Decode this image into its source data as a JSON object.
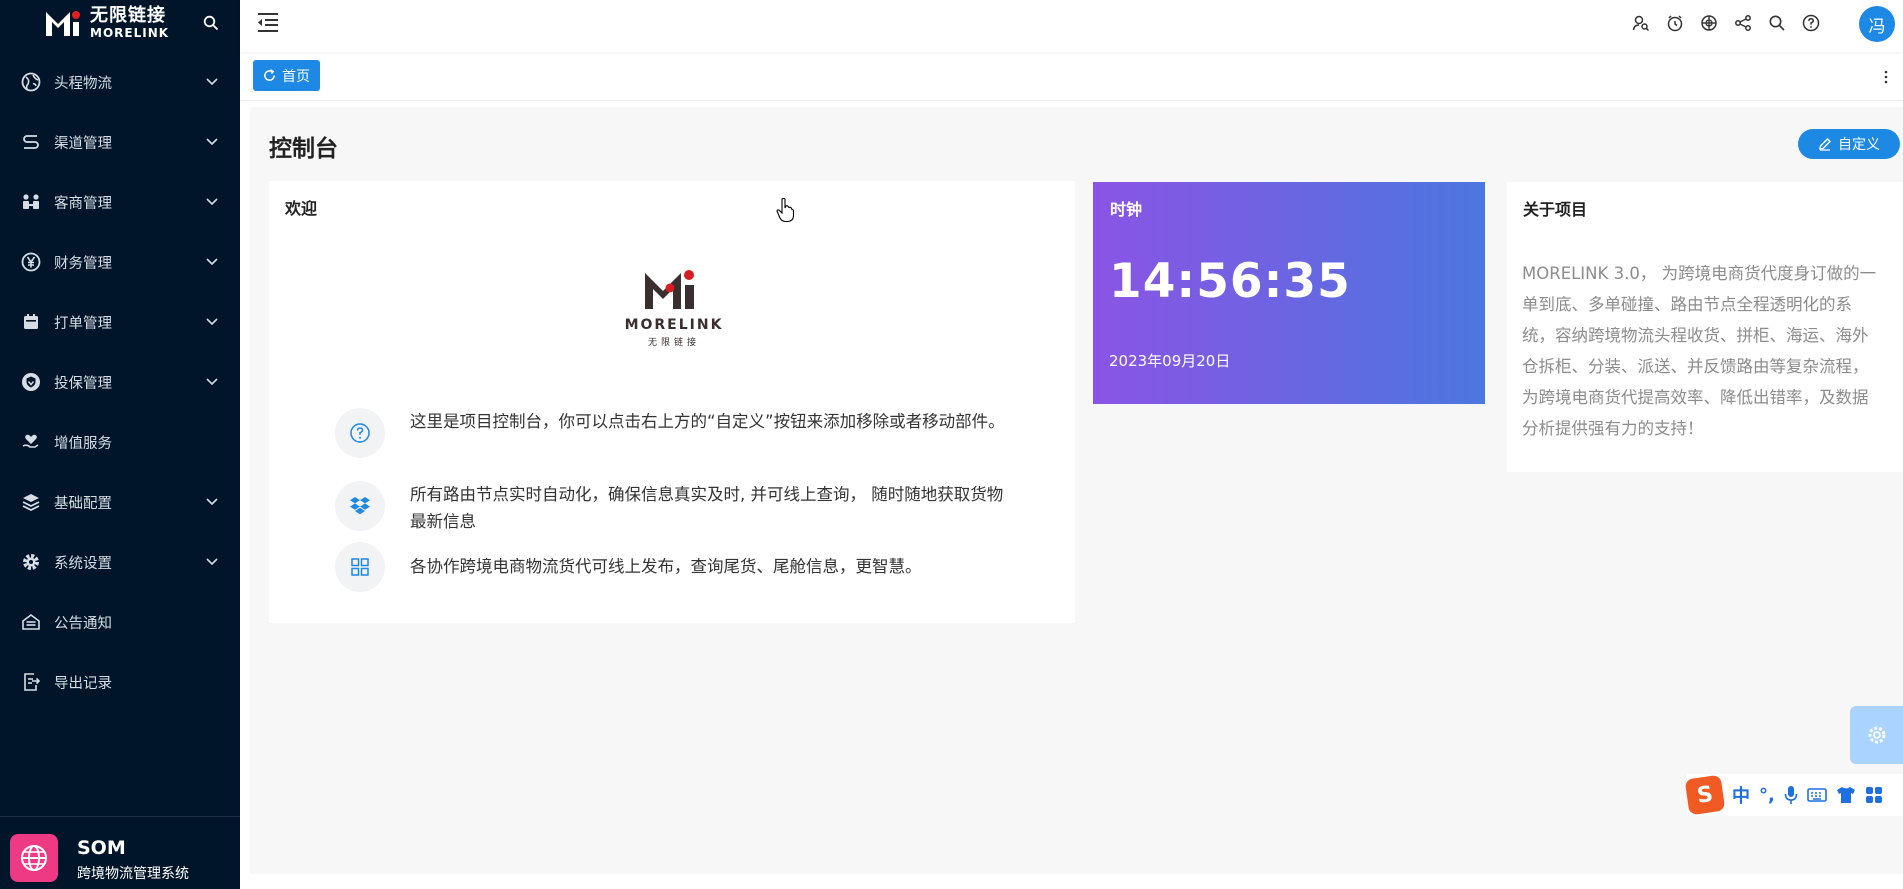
{
  "brand": {
    "name_cn": "无限链接",
    "name_en": "MORELINK"
  },
  "sidebar": {
    "items": [
      {
        "label": "头程物流",
        "icon": "globe-icon",
        "has_arrow": true
      },
      {
        "label": "渠道管理",
        "icon": "route-icon",
        "has_arrow": true
      },
      {
        "label": "客商管理",
        "icon": "users-icon",
        "has_arrow": true
      },
      {
        "label": "财务管理",
        "icon": "yen-icon",
        "has_arrow": true
      },
      {
        "label": "打单管理",
        "icon": "calendar-icon",
        "has_arrow": true
      },
      {
        "label": "投保管理",
        "icon": "shield-icon",
        "has_arrow": true
      },
      {
        "label": "增值服务",
        "icon": "heart-hand-icon",
        "has_arrow": false
      },
      {
        "label": "基础配置",
        "icon": "layers-icon",
        "has_arrow": true
      },
      {
        "label": "系统设置",
        "icon": "gear-icon",
        "has_arrow": true
      },
      {
        "label": "公告通知",
        "icon": "inbox-icon",
        "has_arrow": false
      },
      {
        "label": "导出记录",
        "icon": "export-icon",
        "has_arrow": false
      }
    ],
    "footer": {
      "app_name": "SOM",
      "app_subtitle": "跨境物流管理系统"
    }
  },
  "header": {
    "icons": [
      "user-search-icon",
      "clock-face-icon",
      "globe-grid-icon",
      "share-icon",
      "search-icon",
      "help-icon"
    ],
    "user_initial": "冯"
  },
  "tabs": {
    "home_label": "首页"
  },
  "main": {
    "page_title": "控制台",
    "customize_label": "自定义",
    "welcome": {
      "title": "欢迎",
      "logo_text": "MORELINK",
      "logo_sub": "无限链接",
      "tips": [
        {
          "icon": "question-icon",
          "text": "这里是项目控制台，你可以点击右上方的“自定义”按钮来添加移除或者移动部件。"
        },
        {
          "icon": "dropbox-icon",
          "text": "所有路由节点实时自动化，确保信息真实及时, 并可线上查询， 随时随地获取货物最新信息"
        },
        {
          "icon": "grid-icon",
          "text": "各协作跨境电商物流货代可线上发布，查询尾货、尾舱信息，更智慧。"
        }
      ]
    },
    "clock": {
      "title": "时钟",
      "time": "14:56:35",
      "date": "2023年09月20日"
    },
    "about": {
      "title": "关于项目",
      "text": "MORELINK 3.0， 为跨境电商货代度身订做的一单到底、多单碰撞、路由节点全程透明化的系统，容纳跨境物流头程收货、拼柜、海运、海外仓拆柜、分装、派送、并反馈路由等复杂流程，为跨境电商货代提高效率、降低出错率，及数据分析提供强有力的支持！"
    }
  },
  "ime": {
    "logo": "S",
    "items": [
      "中",
      "°,"
    ]
  },
  "colors": {
    "sidebar_bg": "#001529",
    "accent": "#1e88e5",
    "clock_from": "#8a54e4",
    "clock_to": "#4c76e0"
  }
}
